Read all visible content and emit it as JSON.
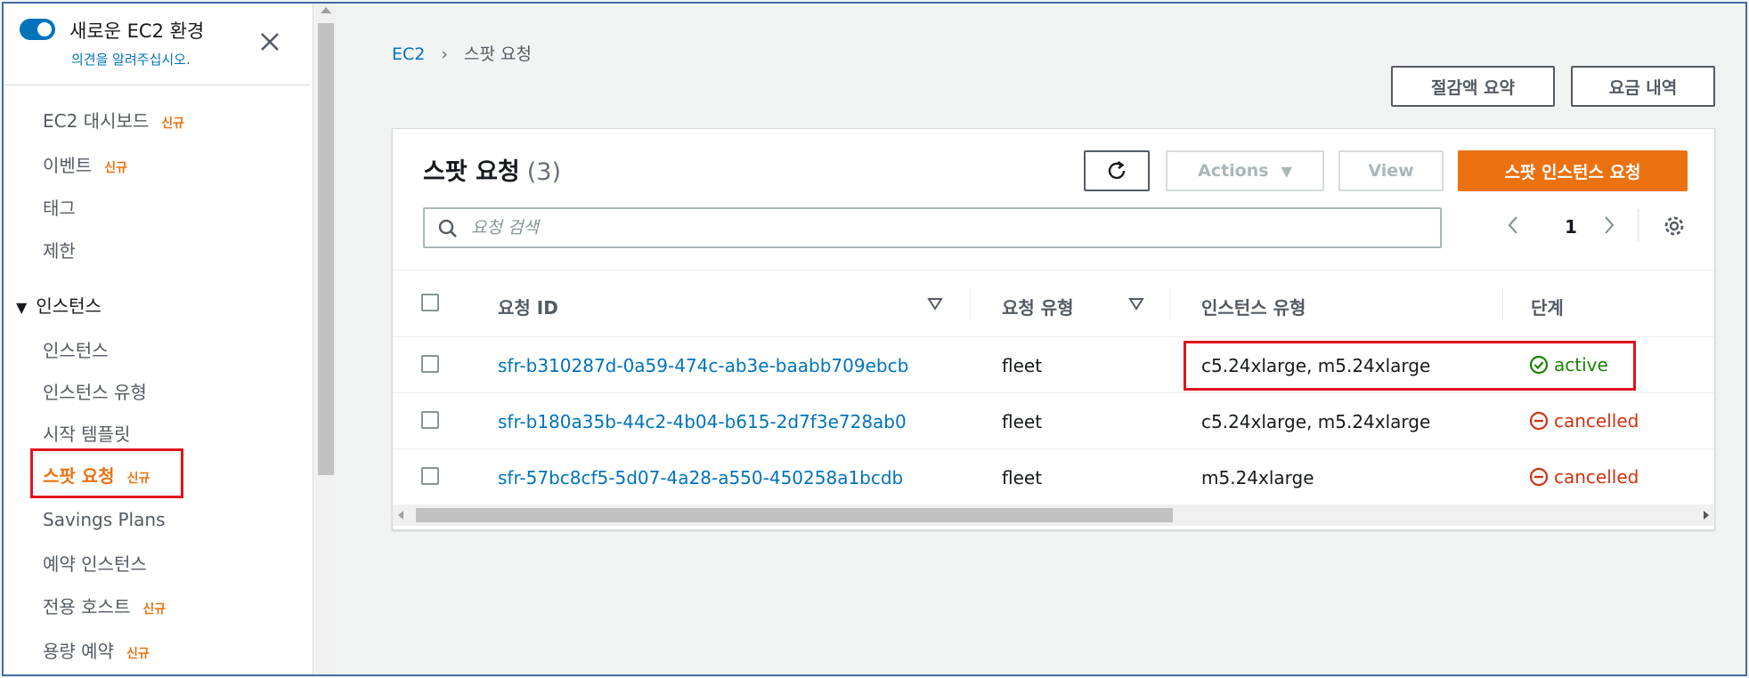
{
  "sidebar": {
    "header_title": "새로운 EC2 환경",
    "feedback_link": "의견을 알려주십시오.",
    "new_badge": "신규",
    "items": [
      {
        "label": "EC2 대시보드",
        "badge": "신규"
      },
      {
        "label": "이벤트",
        "badge": "신규"
      },
      {
        "label": "태그",
        "badge": ""
      },
      {
        "label": "제한",
        "badge": ""
      }
    ],
    "section_title": "인스턴스",
    "section_items": [
      {
        "label": "인스턴스",
        "badge": ""
      },
      {
        "label": "인스턴스 유형",
        "badge": ""
      },
      {
        "label": "시작 템플릿",
        "badge": ""
      },
      {
        "label": "스팟 요청",
        "badge": "신규"
      },
      {
        "label": "Savings Plans",
        "badge": ""
      },
      {
        "label": "예약 인스턴스",
        "badge": ""
      },
      {
        "label": "전용 호스트",
        "badge": "신규"
      },
      {
        "label": "용량 예약",
        "badge": "신규"
      }
    ],
    "active_item": "스팟 요청"
  },
  "breadcrumb": {
    "root": "EC2",
    "current": "스팟 요청"
  },
  "top_buttons": {
    "savings_summary": "절감액 요약",
    "pricing_history": "요금 내역"
  },
  "panel": {
    "title": "스팟 요청",
    "count": "(3)",
    "actions_label": "Actions",
    "view_label": "View",
    "primary_label": "스팟 인스턴스 요청",
    "search_placeholder": "요청 검색",
    "page_number": "1",
    "columns": [
      "요청 ID",
      "요청 유형",
      "인스턴스 유형",
      "단계"
    ],
    "rows": [
      {
        "id": "sfr-b310287d-0a59-474c-ab3e-baabb709ebcb",
        "type": "fleet",
        "instance_type": "c5.24xlarge, m5.24xlarge",
        "state": "active"
      },
      {
        "id": "sfr-b180a35b-44c2-4b04-b615-2d7f3e728ab0",
        "type": "fleet",
        "instance_type": "c5.24xlarge, m5.24xlarge",
        "state": "cancelled"
      },
      {
        "id": "sfr-57bc8cf5-5d07-4a28-a550-450258a1bcdb",
        "type": "fleet",
        "instance_type": "m5.24xlarge",
        "state": "cancelled"
      }
    ]
  },
  "colors": {
    "link": "#0073bb",
    "accent_orange": "#ec7211",
    "status_active": "#1d8102",
    "status_cancelled": "#d13212",
    "highlight_box": "#e0141e"
  }
}
